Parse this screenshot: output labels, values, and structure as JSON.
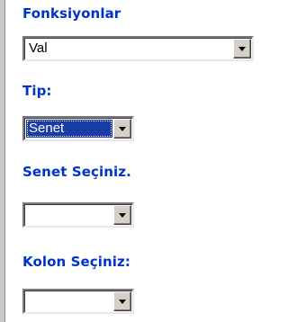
{
  "functions": {
    "label": "Fonksiyonlar",
    "value": "Val"
  },
  "type": {
    "label": "Tip:",
    "value": "Senet"
  },
  "security": {
    "label": "Senet Seçiniz.",
    "value": ""
  },
  "column": {
    "label": "Kolon Seçiniz:",
    "value": ""
  },
  "icons": {
    "dropdown": "chevron-down-icon"
  },
  "colors": {
    "label": "#0033cc",
    "selection": "#1a3ca8"
  }
}
